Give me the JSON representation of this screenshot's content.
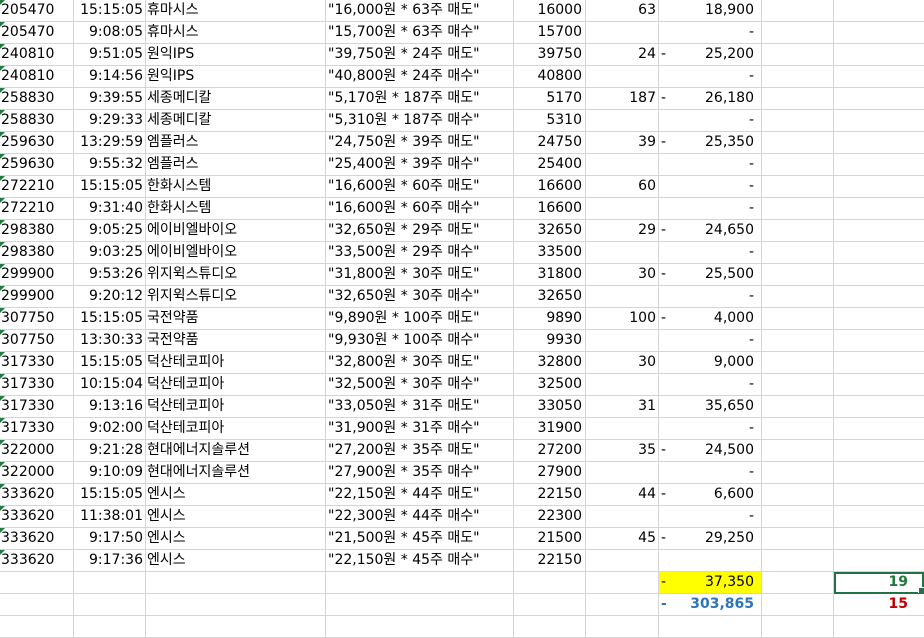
{
  "rows": [
    {
      "code": "205470",
      "time": "15:15:05",
      "name": "휴마시스",
      "desc": "\"16,000원 * 63주 매도\"",
      "price": "16000",
      "qty": "63",
      "dash": "",
      "amt": "18,900"
    },
    {
      "code": "205470",
      "time": "9:08:05",
      "name": "휴마시스",
      "desc": "\"15,700원 * 63주 매수\"",
      "price": "15700",
      "qty": "",
      "dash": "",
      "amt": "-"
    },
    {
      "code": "240810",
      "time": "9:51:05",
      "name": "원익IPS",
      "desc": "\"39,750원 * 24주 매도\"",
      "price": "39750",
      "qty": "24",
      "dash": "-",
      "amt": "25,200"
    },
    {
      "code": "240810",
      "time": "9:14:56",
      "name": "원익IPS",
      "desc": "\"40,800원 * 24주 매수\"",
      "price": "40800",
      "qty": "",
      "dash": "",
      "amt": "-"
    },
    {
      "code": "258830",
      "time": "9:39:55",
      "name": "세종메디칼",
      "desc": "\"5,170원 * 187주 매도\"",
      "price": "5170",
      "qty": "187",
      "dash": "-",
      "amt": "26,180"
    },
    {
      "code": "258830",
      "time": "9:29:33",
      "name": "세종메디칼",
      "desc": "\"5,310원 * 187주 매수\"",
      "price": "5310",
      "qty": "",
      "dash": "",
      "amt": "-"
    },
    {
      "code": "259630",
      "time": "13:29:59",
      "name": "엠플러스",
      "desc": "\"24,750원 * 39주 매도\"",
      "price": "24750",
      "qty": "39",
      "dash": "-",
      "amt": "25,350"
    },
    {
      "code": "259630",
      "time": "9:55:32",
      "name": "엠플러스",
      "desc": "\"25,400원 * 39주 매수\"",
      "price": "25400",
      "qty": "",
      "dash": "",
      "amt": "-"
    },
    {
      "code": "272210",
      "time": "15:15:05",
      "name": "한화시스템",
      "desc": "\"16,600원 * 60주 매도\"",
      "price": "16600",
      "qty": "60",
      "dash": "",
      "amt": "-"
    },
    {
      "code": "272210",
      "time": "9:31:40",
      "name": "한화시스템",
      "desc": "\"16,600원 * 60주 매수\"",
      "price": "16600",
      "qty": "",
      "dash": "",
      "amt": "-"
    },
    {
      "code": "298380",
      "time": "9:05:25",
      "name": "에이비엘바이오",
      "desc": "\"32,650원 * 29주 매도\"",
      "price": "32650",
      "qty": "29",
      "dash": "-",
      "amt": "24,650"
    },
    {
      "code": "298380",
      "time": "9:03:25",
      "name": "에이비엘바이오",
      "desc": "\"33,500원 * 29주 매수\"",
      "price": "33500",
      "qty": "",
      "dash": "",
      "amt": "-"
    },
    {
      "code": "299900",
      "time": "9:53:26",
      "name": "위지윅스튜디오",
      "desc": "\"31,800원 * 30주 매도\"",
      "price": "31800",
      "qty": "30",
      "dash": "-",
      "amt": "25,500"
    },
    {
      "code": "299900",
      "time": "9:20:12",
      "name": "위지윅스튜디오",
      "desc": "\"32,650원 * 30주 매수\"",
      "price": "32650",
      "qty": "",
      "dash": "",
      "amt": "-"
    },
    {
      "code": "307750",
      "time": "15:15:05",
      "name": "국전약품",
      "desc": "\"9,890원 * 100주 매도\"",
      "price": "9890",
      "qty": "100",
      "dash": "-",
      "amt": "4,000"
    },
    {
      "code": "307750",
      "time": "13:30:33",
      "name": "국전약품",
      "desc": "\"9,930원 * 100주 매수\"",
      "price": "9930",
      "qty": "",
      "dash": "",
      "amt": "-"
    },
    {
      "code": "317330",
      "time": "15:15:05",
      "name": "덕산테코피아",
      "desc": "\"32,800원 * 30주 매도\"",
      "price": "32800",
      "qty": "30",
      "dash": "",
      "amt": "9,000"
    },
    {
      "code": "317330",
      "time": "10:15:04",
      "name": "덕산테코피아",
      "desc": "\"32,500원 * 30주 매수\"",
      "price": "32500",
      "qty": "",
      "dash": "",
      "amt": "-"
    },
    {
      "code": "317330",
      "time": "9:13:16",
      "name": "덕산테코피아",
      "desc": "\"33,050원 * 31주 매도\"",
      "price": "33050",
      "qty": "31",
      "dash": "",
      "amt": "35,650"
    },
    {
      "code": "317330",
      "time": "9:02:00",
      "name": "덕산테코피아",
      "desc": "\"31,900원 * 31주 매수\"",
      "price": "31900",
      "qty": "",
      "dash": "",
      "amt": "-"
    },
    {
      "code": "322000",
      "time": "9:21:28",
      "name": "현대에너지솔루션",
      "desc": "\"27,200원 * 35주 매도\"",
      "price": "27200",
      "qty": "35",
      "dash": "-",
      "amt": "24,500"
    },
    {
      "code": "322000",
      "time": "9:10:09",
      "name": "현대에너지솔루션",
      "desc": "\"27,900원 * 35주 매수\"",
      "price": "27900",
      "qty": "",
      "dash": "",
      "amt": "-"
    },
    {
      "code": "333620",
      "time": "15:15:05",
      "name": "엔시스",
      "desc": "\"22,150원 * 44주 매도\"",
      "price": "22150",
      "qty": "44",
      "dash": "-",
      "amt": "6,600"
    },
    {
      "code": "333620",
      "time": "11:38:01",
      "name": "엔시스",
      "desc": "\"22,300원 * 44주 매수\"",
      "price": "22300",
      "qty": "",
      "dash": "",
      "amt": "-"
    },
    {
      "code": "333620",
      "time": "9:17:50",
      "name": "엔시스",
      "desc": "\"21,500원 * 45주 매도\"",
      "price": "21500",
      "qty": "45",
      "dash": "-",
      "amt": "29,250"
    },
    {
      "code": "333620",
      "time": "9:17:36",
      "name": "엔시스",
      "desc": "\"22,150원 * 45주 매수\"",
      "price": "22150",
      "qty": "",
      "dash": "",
      "amt": ""
    }
  ],
  "summary": {
    "total_dash": "-",
    "total_amount": "37,350",
    "total_count": "19",
    "grand_dash": "-",
    "grand_amount": "303,865",
    "grand_count": "15"
  },
  "colors": {
    "highlight": "#ffff00",
    "blue_total": "#2e75b6",
    "green_count": "#1f7a3a",
    "red_count": "#c00000",
    "selection": "#217346",
    "grid": "#d4d4d4"
  }
}
